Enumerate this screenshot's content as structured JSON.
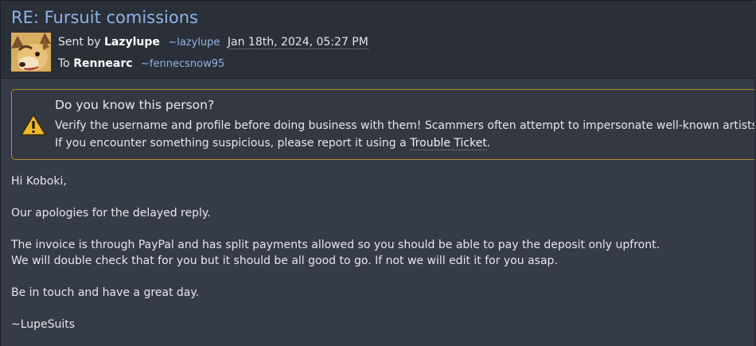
{
  "message": {
    "subject": "RE: Fursuit comissions",
    "sent_by_prefix": "Sent by",
    "sender_name": "Lazylupe",
    "sender_handle": "~lazylupe",
    "date": "Jan 18th, 2024, 05:27 PM",
    "to_prefix": "To",
    "recipient_name": "Rennearc",
    "recipient_handle": "~fennecsnow95"
  },
  "warning": {
    "title": "Do you know this person?",
    "line1": "Verify the username and profile before doing business with them! Scammers often attempt to impersonate well-known artists.",
    "line2_prefix": "If you encounter something suspicious, please report it using a",
    "link_text": "Trouble Ticket",
    "line2_suffix": ".",
    "icon": "warning-triangle-icon",
    "accent_color": "#b28a2c"
  },
  "body": {
    "greeting": "Hi Koboki,",
    "p1": "Our apologies for the delayed reply.",
    "p2_line1": "The invoice is through PayPal and has split payments allowed so you should be able to pay the deposit only upfront.",
    "p2_line2": "We will double check that for you but it should be all good to go. If not we will edit it for you asap.",
    "p3": "Be in touch and have a great day.",
    "signature": "~LupeSuits"
  },
  "colors": {
    "background": "#353b47",
    "header_background": "#2a2f38",
    "link": "#8fb4e6"
  }
}
